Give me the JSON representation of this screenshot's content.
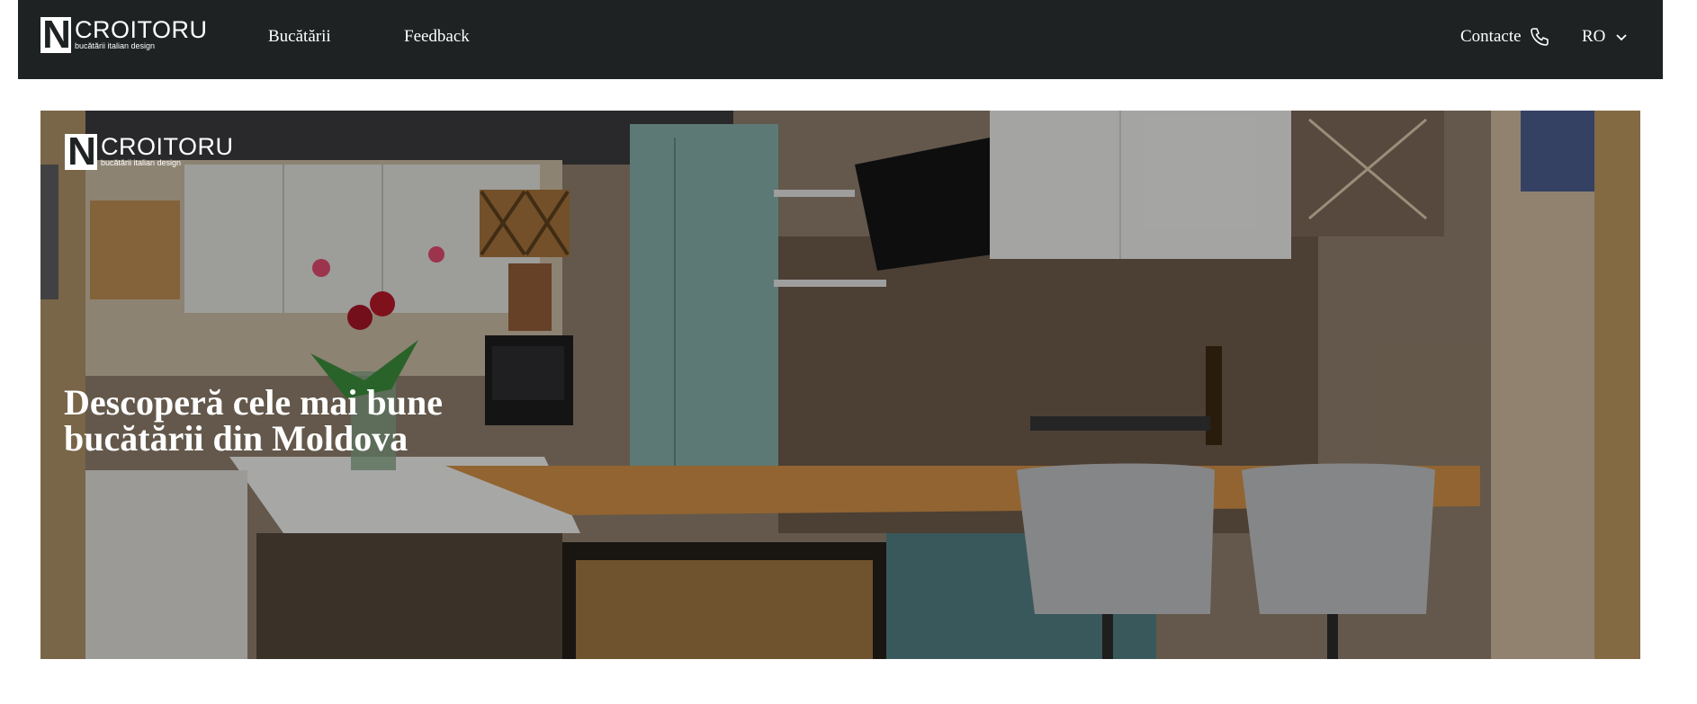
{
  "nav": {
    "logo_name": "CROITORU",
    "logo_tagline": "bucătării italian design",
    "links": [
      "Bucătării",
      "Feedback"
    ],
    "contact_label": "Contacte",
    "language": "RO",
    "icons": {
      "contact": "phone-icon",
      "language": "chevron-down-icon"
    }
  },
  "hero": {
    "logo_name": "CROITORU",
    "logo_tagline": "bucătării italian design",
    "title_line1": "Descoperă cele mai bune",
    "title_line2": "bucătării din Moldova"
  },
  "colors": {
    "navbar_bg": "#1e2222",
    "text": "#ffffff"
  }
}
